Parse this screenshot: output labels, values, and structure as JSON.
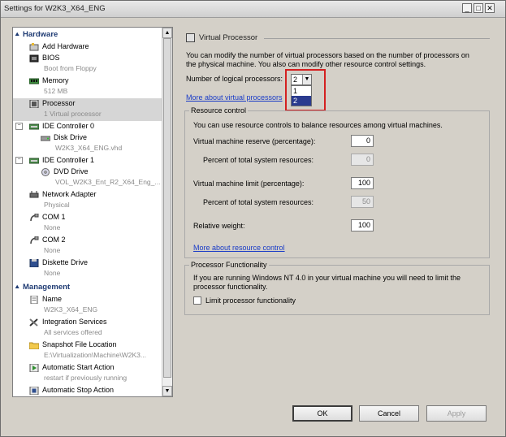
{
  "window": {
    "title": "Settings for W2K3_X64_ENG"
  },
  "left": {
    "hardware_header": "Hardware",
    "management_header": "Management",
    "hardware_items": [
      {
        "name": "Add Hardware",
        "sub": ""
      },
      {
        "name": "BIOS",
        "sub": "Boot from Floppy"
      },
      {
        "name": "Memory",
        "sub": "512 MB"
      },
      {
        "name": "Processor",
        "sub": "1 Virtual processor"
      },
      {
        "name": "IDE Controller 0",
        "sub": ""
      },
      {
        "name": "Disk Drive",
        "sub": "W2K3_X64_ENG.vhd"
      },
      {
        "name": "IDE Controller 1",
        "sub": ""
      },
      {
        "name": "DVD Drive",
        "sub": "VOL_W2K3_Ent_R2_X64_Eng_..."
      },
      {
        "name": "Network Adapter",
        "sub": "Physical"
      },
      {
        "name": "COM 1",
        "sub": "None"
      },
      {
        "name": "COM 2",
        "sub": "None"
      },
      {
        "name": "Diskette Drive",
        "sub": "None"
      }
    ],
    "management_items": [
      {
        "name": "Name",
        "sub": "W2K3_X64_ENG"
      },
      {
        "name": "Integration Services",
        "sub": "All services offered"
      },
      {
        "name": "Snapshot File Location",
        "sub": "E:\\Virtualization\\Machine\\W2K3..."
      },
      {
        "name": "Automatic Start Action",
        "sub": "restart if previously running"
      },
      {
        "name": "Automatic Stop Action",
        "sub": ""
      }
    ]
  },
  "right": {
    "heading": "Virtual Processor",
    "intro_line1": "You can modify the number of virtual processors based on the number of processors on",
    "intro_line2": "the physical machine. You also can modify other resource control settings.",
    "num_label": "Number of logical processors:",
    "num_value": "2",
    "num_options": [
      "1",
      "2"
    ],
    "link_vp": "More about virtual processors",
    "resource_title": "Resource control",
    "resource_intro": "You can use resource controls to balance resources among virtual machines.",
    "reserve_label": "Virtual machine reserve (percentage):",
    "reserve_value": "0",
    "reserve_pct_label": "Percent of total system resources:",
    "reserve_pct_value": "0",
    "limit_label": "Virtual machine limit (percentage):",
    "limit_value": "100",
    "limit_pct_label": "Percent of total system resources:",
    "limit_pct_value": "50",
    "weight_label": "Relative weight:",
    "weight_value": "100",
    "link_rc": "More about resource control",
    "pf_title": "Processor Functionality",
    "pf_line1": "If you are running Windows NT 4.0 in your virtual machine you will need to limit the",
    "pf_line2": "processor functionality.",
    "pf_checkbox_label": "Limit processor functionality"
  },
  "buttons": {
    "ok": "OK",
    "cancel": "Cancel",
    "apply": "Apply"
  },
  "colors": {
    "highlight": "#d42020",
    "link": "#1a3cc7",
    "section": "#1f3b73"
  }
}
